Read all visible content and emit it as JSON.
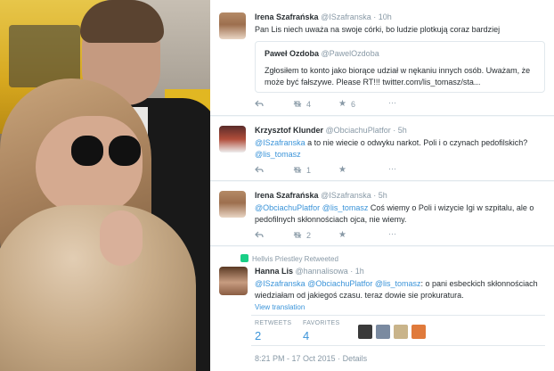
{
  "tweets": [
    {
      "name": "Irena Szafrańska",
      "handle": "@ISzafranska",
      "time": "· 10h",
      "text": "Pan Lis niech uważa na swoje córki, bo ludzie plotkują coraz bardziej",
      "quote": {
        "name": "Paweł Ozdoba",
        "handle": "@PawelOzdoba",
        "text": "Zgłosiłem to konto jako biorące udział w nękaniu innych osób. Uważam, że może być fałszywe. Please RT!!! twitter.com/lis_tomasz/sta..."
      },
      "retweets": "4",
      "favorites": "6"
    },
    {
      "name": "Krzysztof Klunder",
      "handle": "@ObciachuPlatfor",
      "time": "· 5h",
      "mention_lead": "@ISzafranska",
      "text": " a to nie wiecie o odwyku narkot. Poli i o czynach pedofilskich?",
      "mention_tail": "@lis_tomasz",
      "retweets": "1",
      "favorites": ""
    },
    {
      "name": "Irena Szafrańska",
      "handle": "@ISzafranska",
      "time": "· 5h",
      "mention_lead": "@ObciachuPlatfor",
      "mention_lead2": "@lis_tomasz",
      "text": " Coś wiemy o Poli i wizycie Igi w szpitalu, ale o pedofilnych skłonnościach ojca, nie wiemy.",
      "retweets": "2",
      "favorites": ""
    }
  ],
  "retweeted_bar": "Hellvis Priestley Retweeted",
  "main_tweet": {
    "name": "Hanna Lis",
    "handle": "@hannalisowa",
    "time": "· 1h",
    "mention1": "@ISzafranska",
    "mention2": "@ObciachuPlatfor",
    "mention3": "@lis_tomasz",
    "text": ": o pani esbeckich skłonnościach wiedziałam od jakiegoś czasu. teraz dowie sie prokuratura.",
    "view_translation": "View translation",
    "retweets_label": "RETWEETS",
    "retweets_count": "2",
    "favorites_label": "FAVORITES",
    "favorites_count": "4",
    "timestamp": "8:21 PM - 17 Oct 2015",
    "details": "· Details"
  },
  "colors": {
    "link": "#3b94d9",
    "retweet_green": "#19cf86",
    "muted": "#8899a6"
  },
  "icons": [
    "reply-icon",
    "retweet-icon",
    "favorite-icon",
    "more-icon"
  ]
}
